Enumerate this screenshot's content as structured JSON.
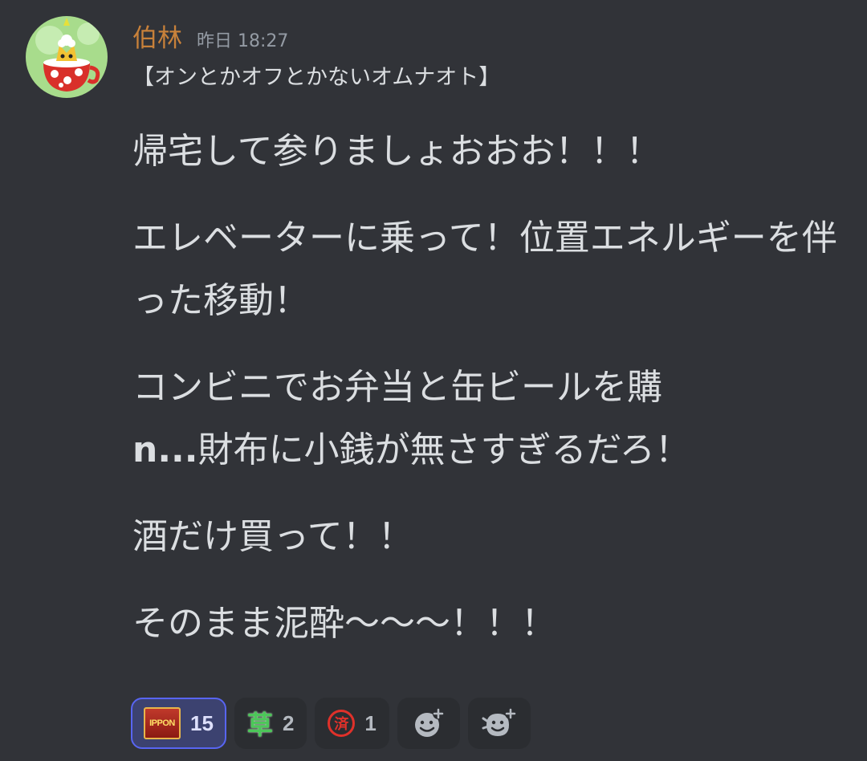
{
  "author": {
    "name": "伯林",
    "timestamp": "昨日 18:27"
  },
  "subtitle": "【オンとかオフとかないオムナオト】",
  "message": {
    "paragraphs": [
      "帰宅して参りましょおおお！！！",
      "エレベーターに乗って！位置エネルギーを伴った移動！",
      "コンビニでお弁当と缶ビールを購",
      "酒だけ買って！！",
      "そのまま泥酔〜〜〜！！！"
    ],
    "bold_prefix": "n...",
    "after_bold": "財布に小銭が無さすぎるだろ！"
  },
  "reactions": [
    {
      "emoji": "ippon-emoji",
      "label": "IPPON",
      "count": "15",
      "active": true
    },
    {
      "emoji": "kusa-emoji",
      "label": "草",
      "count": "2",
      "active": false
    },
    {
      "emoji": "sumi-emoji",
      "label": "済",
      "count": "1",
      "active": false
    }
  ],
  "colors": {
    "background": "#313338",
    "username": "#c8813a",
    "text": "#dbdee1",
    "accent": "#5865f2"
  }
}
